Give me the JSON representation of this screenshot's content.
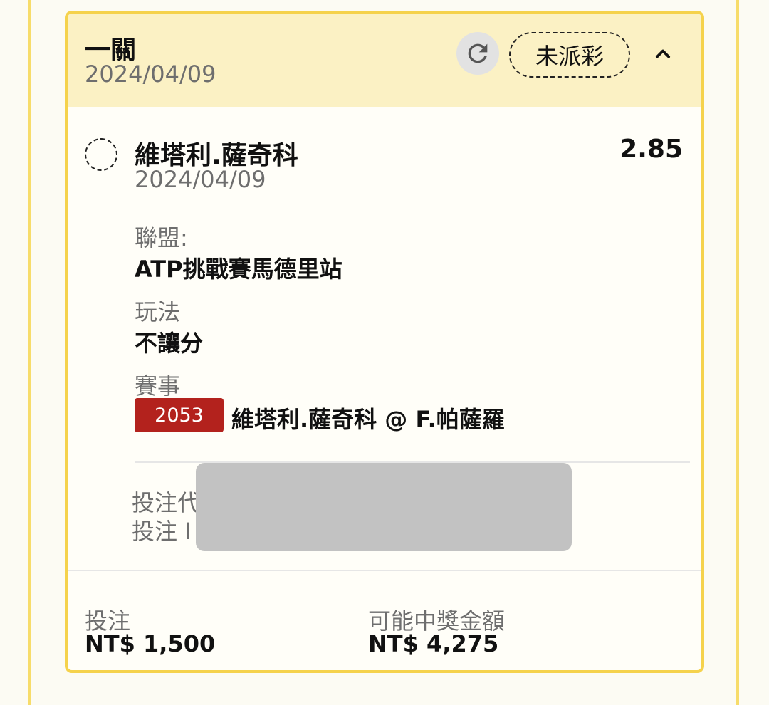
{
  "header": {
    "title": "一關",
    "date": "2024/04/09",
    "status": "未派彩"
  },
  "selection": {
    "name": "維塔利.薩奇科",
    "date": "2024/04/09",
    "odds": "2.85"
  },
  "fields": {
    "league_label": "聯盟:",
    "league_value": "ATP挑戰賽馬德里站",
    "market_label": "玩法",
    "market_value": "不讓分",
    "event_label": "賽事",
    "event_id": "2053",
    "event_name": "維塔利.薩奇科 @ F.帕薩羅"
  },
  "bet_info": {
    "code_label": "投注代",
    "id_label": "投注 I"
  },
  "footer": {
    "stake_label": "投注",
    "stake_value": "NT$ 1,500",
    "payout_label": "可能中獎金額",
    "payout_value": "NT$ 4,275"
  },
  "colors": {
    "card_border": "#f5d24c",
    "header_bg": "#fbf1c4",
    "match_badge": "#b3221d"
  },
  "icons": [
    "refresh-icon",
    "chevron-up-icon"
  ]
}
